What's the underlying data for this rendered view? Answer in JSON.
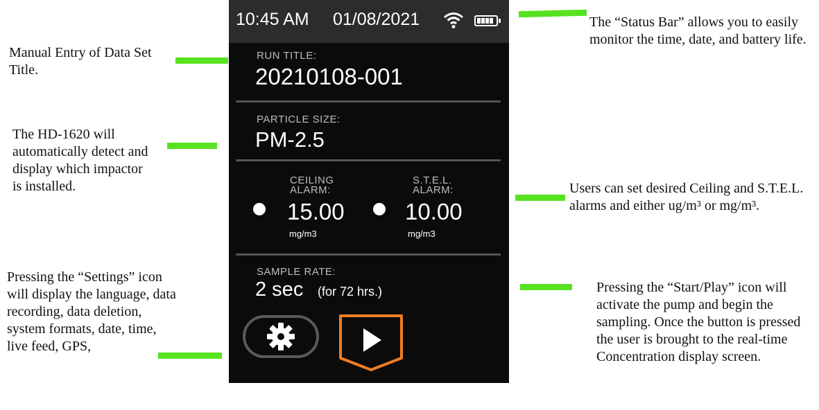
{
  "annotations": {
    "left_title": "Manual Entry of Data Set Title.",
    "left_impactor": "The HD-1620 will automatically detect and display which impactor is installed.",
    "left_settings": "Pressing the “Settings” icon will display the language, data recording, data deletion, system formats, date, time, live feed, GPS,",
    "right_status": "The “Status Bar” allows you to easily monitor the time, date, and battery life.",
    "right_alarms": "Users can set desired Ceiling and S.T.E.L. alarms and either ug/m³ or mg/m³.",
    "right_start": "Pressing the “Start/Play” icon will activate the pump and begin the sampling. Once the button is pressed the user is brought to the real-time Concentration display screen."
  },
  "colors": {
    "annotation_bar": "#56e21f",
    "play_button": "#f07d22",
    "status_bar_bg": "#2c2c2c"
  },
  "device": {
    "status": {
      "time": "10:45 AM",
      "date": "01/08/2021",
      "wifi_icon": "wifi-icon",
      "battery_icon": "battery-icon"
    },
    "run_title": {
      "label": "RUN TITLE:",
      "value": "20210108-001"
    },
    "particle_size": {
      "label": "PARTICLE SIZE:",
      "value": "PM-2.5"
    },
    "ceiling": {
      "label_1": "CEILING",
      "label_2": "ALARM:",
      "value": "15.00",
      "unit": "mg/m3"
    },
    "stel": {
      "label_1": "S.T.E.L.",
      "label_2": "ALARM:",
      "value": "10.00",
      "unit": "mg/m3"
    },
    "sample_rate": {
      "label": "SAMPLE RATE:",
      "value": "2 sec",
      "detail": "(for 72 hrs.)"
    },
    "buttons": {
      "settings_icon": "gear-icon",
      "start_icon": "play-icon"
    }
  }
}
